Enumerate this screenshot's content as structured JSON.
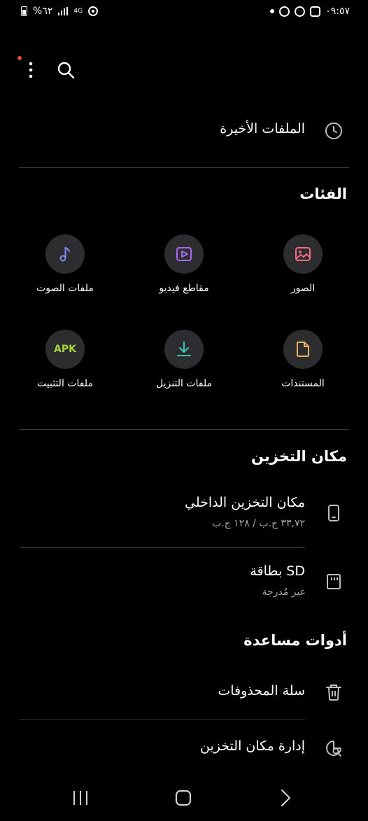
{
  "status_bar": {
    "time": "٠٩:٥٧",
    "battery_percent": "%٦٢",
    "network": "4G"
  },
  "top_bar": {
    "has_notification_dot": true,
    "colors": {
      "notification_dot": "#e0542d"
    }
  },
  "recent": {
    "label": "الملفات الأخيرة",
    "icon": "clock-icon"
  },
  "categories": {
    "title": "الفئات",
    "items": [
      {
        "label": "الصور",
        "icon": "image-icon",
        "color": "#f06a8a"
      },
      {
        "label": "مقاطع فيديو",
        "icon": "video-icon",
        "color": "#a26bf0"
      },
      {
        "label": "ملفات الصوت",
        "icon": "music-note-icon",
        "color": "#7b8cf5"
      },
      {
        "label": "المستندات",
        "icon": "document-icon",
        "color": "#f2b26b"
      },
      {
        "label": "ملفات التنزيل",
        "icon": "download-icon",
        "color": "#36c7b0"
      },
      {
        "label": "ملفات التثبيت",
        "icon": "apk-icon",
        "badge": "APK",
        "color": "#a4d63b"
      }
    ]
  },
  "storage": {
    "title": "مكان التخزين",
    "items": [
      {
        "label": "مكان التخزين الداخلي",
        "sub": "٣٣,٧٢ ج.ب / ١٢٨ ج.ب",
        "icon": "phone-icon"
      },
      {
        "label": "بطاقة SD",
        "sub": "غير مُدرجة",
        "icon": "sd-card-icon"
      }
    ]
  },
  "tools": {
    "title": "أدوات مساعدة",
    "items": [
      {
        "label": "سلة المحذوفات",
        "icon": "trash-icon"
      },
      {
        "label": "إدارة مكان التخزين",
        "icon": "storage-manage-icon"
      }
    ]
  }
}
